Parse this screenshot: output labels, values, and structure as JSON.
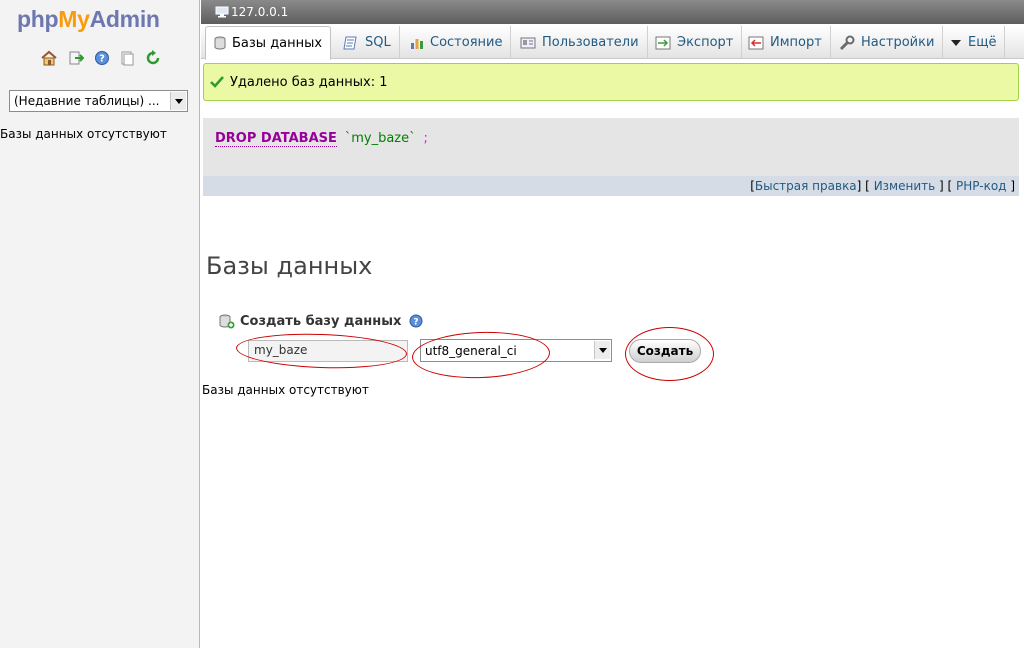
{
  "logo": {
    "php": "php",
    "my": "My",
    "admin": "Admin"
  },
  "nav": {
    "icons": [
      "home-icon",
      "logout-icon",
      "query-window-icon",
      "documentation-icon",
      "reload-icon"
    ],
    "recent_tables": {
      "selected": "(Недавние таблицы) ..."
    },
    "empty_text": "Базы данных отсутствуют"
  },
  "server": {
    "name": "127.0.0.1"
  },
  "tabs": [
    {
      "label": "Базы данных",
      "icon": "database-icon",
      "active": true
    },
    {
      "label": "SQL",
      "icon": "sql-icon"
    },
    {
      "label": "Состояние",
      "icon": "status-icon"
    },
    {
      "label": "Пользователи",
      "icon": "users-icon"
    },
    {
      "label": "Экспорт",
      "icon": "export-icon"
    },
    {
      "label": "Импорт",
      "icon": "import-icon"
    },
    {
      "label": "Настройки",
      "icon": "settings-icon"
    },
    {
      "label": "Ещё",
      "icon": "more-icon"
    }
  ],
  "message": {
    "text": "Удалено баз данных: 1"
  },
  "sql": {
    "keyword": "DROP DATABASE",
    "identifier": "`my_baze`",
    "terminator": ";"
  },
  "sql_links": {
    "open1": "[",
    "inline_edit": "Быстрая правка",
    "sep1": "] [",
    "edit": "Изменить",
    "sep2": "] [",
    "php_code": "PHP-код",
    "close": "]"
  },
  "page": {
    "title": "Базы данных",
    "empty_text": "Базы данных отсутствуют"
  },
  "create": {
    "legend": "Создать базу данных",
    "db_name_value": "my_baze",
    "collation_value": "utf8_general_ci",
    "button_label": "Создать"
  },
  "colors": {
    "accent": "#235a81",
    "success_bg": "#ebf8a4",
    "highlight": "#cc0000"
  }
}
